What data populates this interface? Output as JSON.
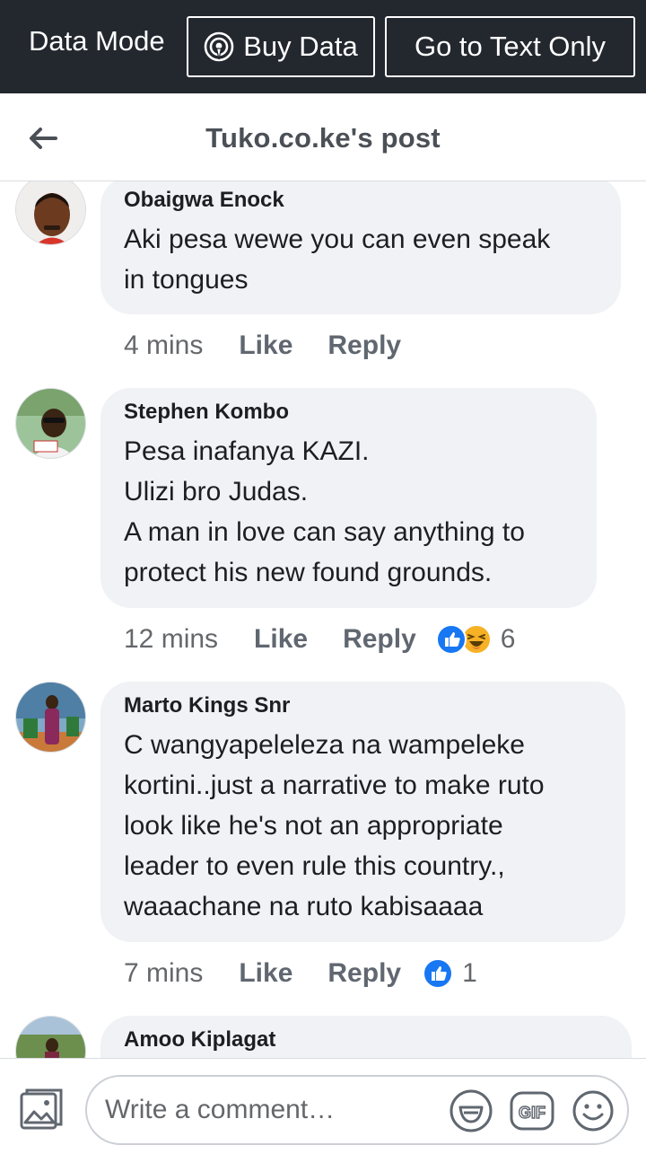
{
  "databar": {
    "mode_label": "Data Mode",
    "buy_label": "Buy Data",
    "text_only_label": "Go to Text Only"
  },
  "header": {
    "title": "Tuko.co.ke's post"
  },
  "comments": [
    {
      "name": "Obaigwa Enock",
      "text": "Aki pesa wewe you can even speak\nin tongues",
      "time": "4 mins",
      "like": "Like",
      "reply": "Reply",
      "reactions": [],
      "reaction_count": ""
    },
    {
      "name": "Stephen Kombo",
      "text": "Pesa inafanya KAZI.\nUlizi bro Judas.\nA man in love can say anything to\nprotect his new found grounds.",
      "time": "12 mins",
      "like": "Like",
      "reply": "Reply",
      "reactions": [
        "like",
        "haha"
      ],
      "reaction_count": "6"
    },
    {
      "name": "Marto Kings Snr",
      "text": "C wangyapeleleza na  wampeleke\nkortini..just a narrative to make ruto\nlook like he's not an appropriate\nleader to even rule this country.,\nwaaachane na ruto kabisaaaa",
      "time": "7 mins",
      "like": "Like",
      "reply": "Reply",
      "reactions": [
        "like"
      ],
      "reaction_count": "1"
    },
    {
      "name": "Amoo Kiplagat",
      "text": "",
      "time": "",
      "like": "",
      "reply": "",
      "reactions": [],
      "reaction_count": ""
    }
  ],
  "composer": {
    "placeholder": "Write a comment…",
    "icons": [
      "photo-icon",
      "sticker-icon",
      "gif-icon",
      "emoji-icon"
    ]
  },
  "colors": {
    "databar_bg": "#23272e",
    "bubble_bg": "#f0f2f5",
    "like_blue": "#1877f2",
    "haha_yellow": "#f7b125",
    "header_title": "#4b4f56",
    "meta_gray": "#65676b"
  }
}
